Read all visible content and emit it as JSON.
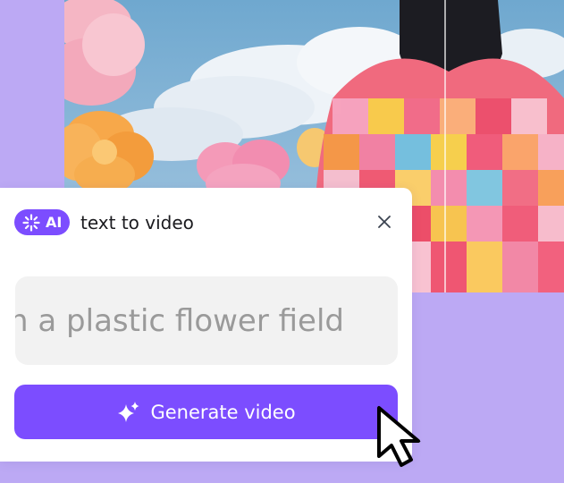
{
  "panel": {
    "badge_label": "AI",
    "title": "text to video",
    "close_icon": "close-icon"
  },
  "prompt": {
    "value": "n a plastic flower field"
  },
  "generate_button": {
    "label": "Generate video",
    "icon": "sparkle-icon"
  },
  "colors": {
    "accent": "#7c4dff",
    "background": "#bca9f4",
    "input_bg": "#f2f2f2",
    "text_dark": "#1b1b1f",
    "text_muted": "#9a9a9a"
  },
  "icons": [
    "ai-sparkle-icon",
    "close-icon",
    "sparkle-icon",
    "mouse-pointer-icon"
  ]
}
